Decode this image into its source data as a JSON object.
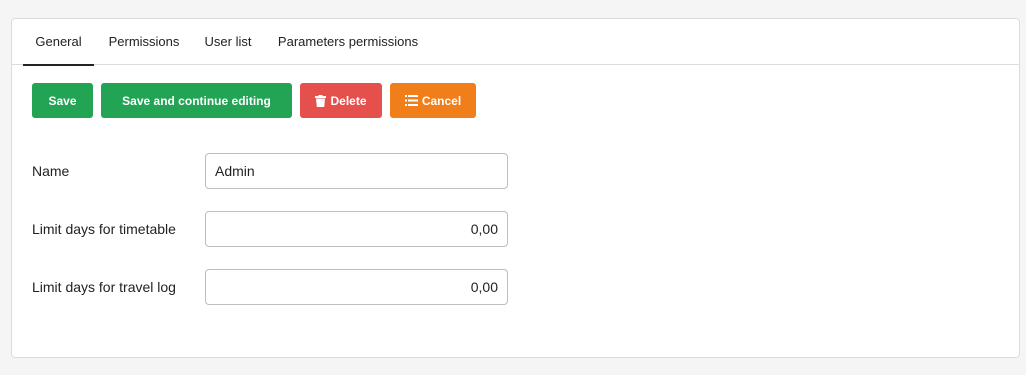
{
  "tabs": [
    {
      "label": "General",
      "active": true
    },
    {
      "label": "Permissions",
      "active": false
    },
    {
      "label": "User list",
      "active": false
    },
    {
      "label": "Parameters permissions",
      "active": false
    }
  ],
  "toolbar": {
    "save_label": "Save",
    "save_continue_label": "Save and continue editing",
    "delete_label": "Delete",
    "cancel_label": "Cancel",
    "delete_icon": "trash-icon",
    "cancel_icon": "list-icon"
  },
  "colors": {
    "save": "#23a455",
    "delete": "#e5504d",
    "cancel": "#f07e1b"
  },
  "form": {
    "name": {
      "label": "Name",
      "value": "Admin"
    },
    "limit_timetable": {
      "label": "Limit days for timetable",
      "value": "0,00"
    },
    "limit_travel_log": {
      "label": "Limit days for travel log",
      "value": "0,00"
    }
  }
}
